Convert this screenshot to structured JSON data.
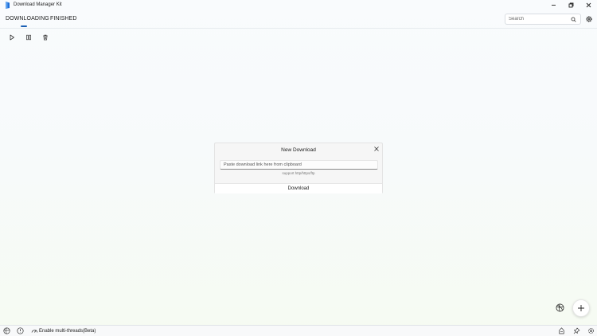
{
  "window": {
    "title": "Download Manager Kit"
  },
  "tabs": [
    {
      "label": "DOWNLOADING",
      "active": true
    },
    {
      "label": "FINISHED",
      "active": false
    }
  ],
  "search": {
    "placeholder": "Search",
    "value": ""
  },
  "dialog": {
    "title": "New Download",
    "input_placeholder": "Paste download link here from clipboard",
    "support_text": "support http/https/ftp",
    "button_label": "Download"
  },
  "status_bar": {
    "multithread_label": "Enable multi-threads(Beta)"
  },
  "colors": {
    "accent": "#1a5fb4",
    "app_icon": "#1e6fd9"
  },
  "icons": {
    "toolbar": [
      "play-icon",
      "pause-icon",
      "trash-icon"
    ],
    "fab": [
      "basketball-icon",
      "plus-icon"
    ],
    "status_left": [
      "basketball-icon",
      "info-icon",
      "tachometer-icon"
    ],
    "status_right": [
      "ticket-icon",
      "pin-icon",
      "gear-icon"
    ]
  }
}
